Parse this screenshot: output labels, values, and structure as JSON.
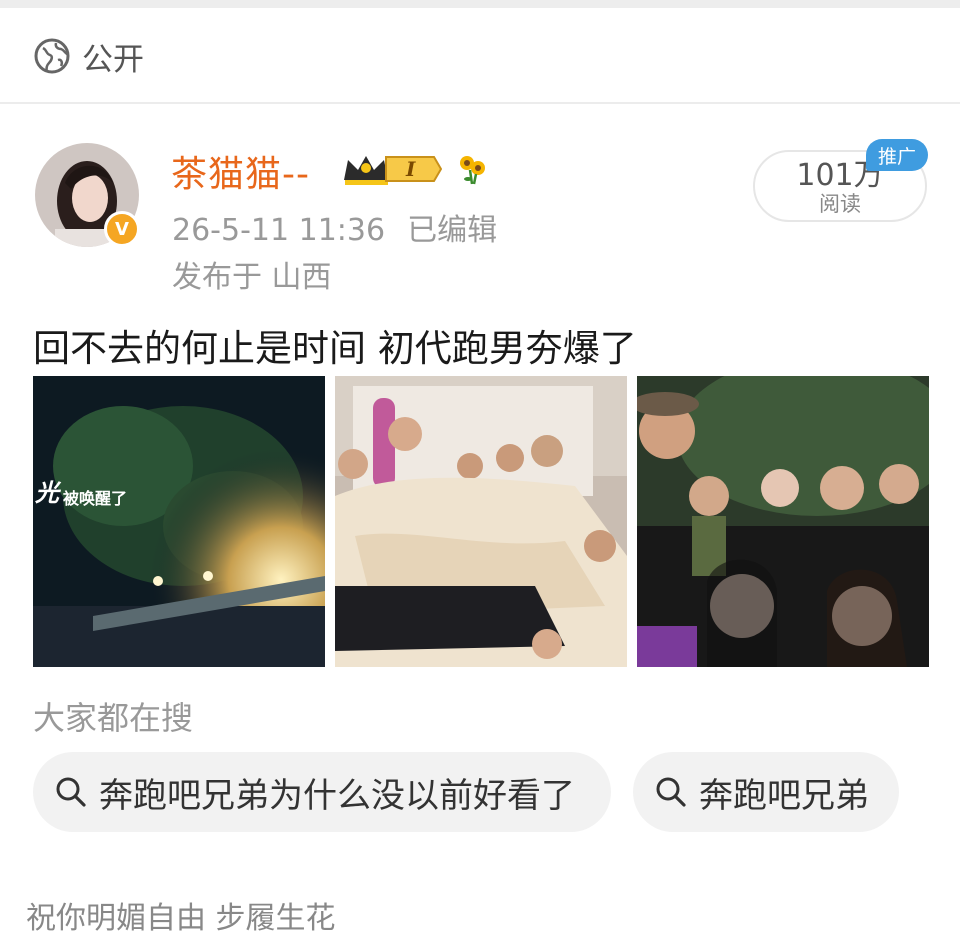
{
  "visibility": {
    "icon": "globe-icon",
    "label": "公开"
  },
  "post": {
    "author": {
      "name": "茶猫猫--",
      "verified_badge": "V",
      "level_badge": "I",
      "crown_icon": "crown-icon",
      "flower_icon": "sunflower-icon"
    },
    "time": "26-5-11 11:36",
    "edited": "已编辑",
    "location": "发布于 山西",
    "reads": {
      "count": "101万",
      "label": "阅读"
    },
    "promo_badge": "推广",
    "text": "回不去的何止是时间 初代跑男夯爆了",
    "images": [
      {
        "desc": "night-scene",
        "caption": "被唤醒了",
        "caption_prefix": "光"
      },
      {
        "desc": "group-in-bed"
      },
      {
        "desc": "group-selfie"
      }
    ]
  },
  "search": {
    "title": "大家都在搜",
    "chips": [
      "奔跑吧兄弟为什么没以前好看了",
      "奔跑吧兄弟"
    ]
  },
  "comment": {
    "text": "祝你明媚自由 步履生花"
  },
  "colors": {
    "username": "#e8671b",
    "promo_bg": "#3f9ce0",
    "badge_gold": "#f5a623",
    "meta_gray": "#999999"
  }
}
